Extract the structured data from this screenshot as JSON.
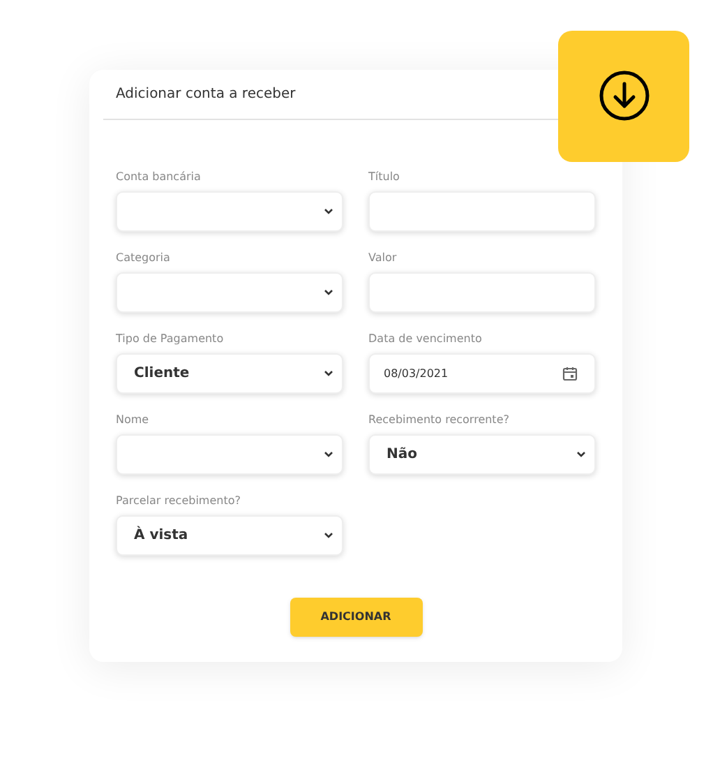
{
  "card": {
    "title": "Adicionar conta a receber"
  },
  "fields": [
    {
      "label": "Conta bancária",
      "kind": "select"
    },
    {
      "label": "Título",
      "kind": "text"
    },
    {
      "label": "Categoria",
      "kind": "select"
    },
    {
      "label": "Valor",
      "kind": "text"
    },
    {
      "label": "Tipo de Pagamento",
      "kind": "select",
      "value": "Cliente"
    },
    {
      "label": "Data de vencimento",
      "kind": "date",
      "value": "08/03/2021"
    },
    {
      "label": "Nome",
      "kind": "select"
    },
    {
      "label": "Recebimento recorrente?",
      "kind": "select",
      "value": "Não"
    },
    {
      "label": "Parcelar recebimento?",
      "kind": "select",
      "value": "À vista"
    }
  ],
  "submit": {
    "label": "ADICIONAR"
  }
}
